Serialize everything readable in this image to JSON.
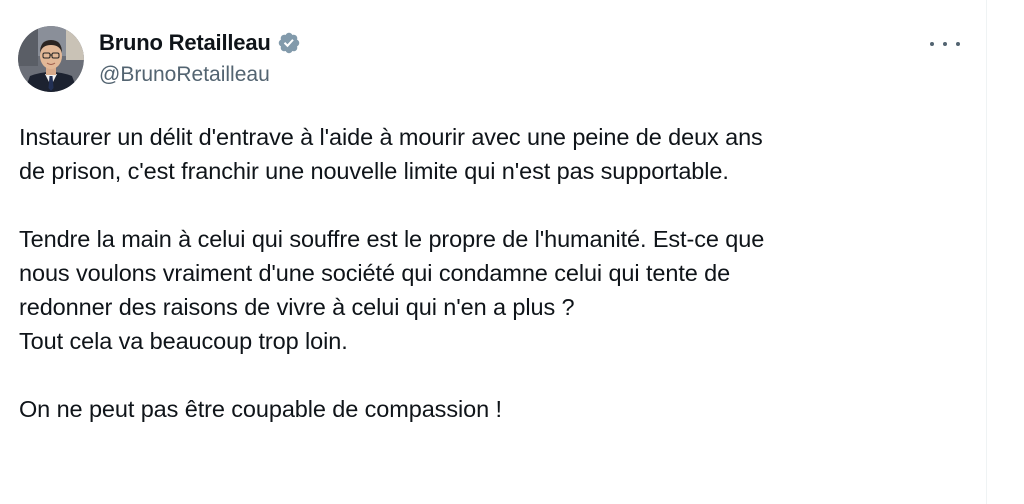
{
  "author": {
    "display_name": "Bruno Retailleau",
    "handle": "@BrunoRetailleau",
    "verified": true,
    "verified_color": "#829aab",
    "avatar_icon": "profile-photo"
  },
  "actions": {
    "more_icon": "more-options-icon"
  },
  "tweet": {
    "lines": [
      "Instaurer un délit d'entrave à l'aide à mourir avec une peine de deux ans",
      "de prison, c'est franchir une nouvelle limite qui n'est pas supportable.",
      "Tendre la main à celui qui souffre est le propre de l'humanité. Est-ce que",
      "nous voulons vraiment d'une société qui condamne celui qui tente de",
      "redonner des raisons de vivre à celui qui n'en a plus ?",
      "Tout cela va beaucoup trop loin.",
      "On ne peut pas être coupable de compassion !"
    ]
  },
  "colors": {
    "text": "#0f1419",
    "secondary": "#536471",
    "background": "#ffffff"
  }
}
